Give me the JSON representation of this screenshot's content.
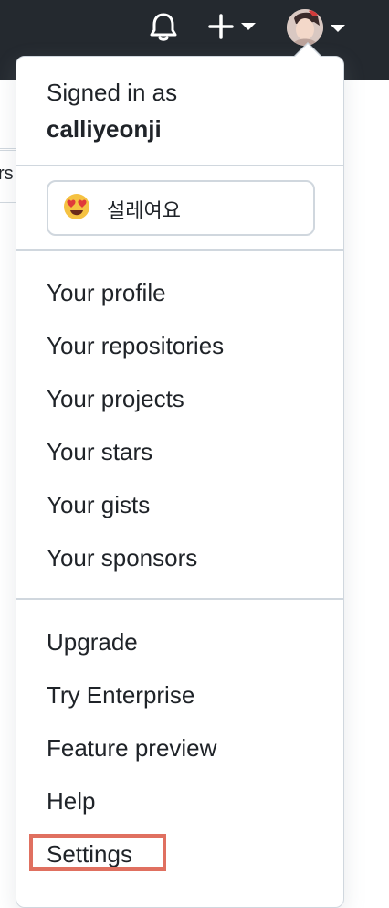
{
  "header": {
    "notifications_icon": "bell-icon",
    "create_icon": "plus-icon",
    "avatar_icon": "avatar"
  },
  "background": {
    "cut_text": "rs"
  },
  "menu": {
    "signed_in_label": "Signed in as",
    "username": "calliyeonji",
    "status": {
      "emoji": "heart-eyes-emoji",
      "text": "설레여요"
    },
    "group1": [
      "Your profile",
      "Your repositories",
      "Your projects",
      "Your stars",
      "Your gists",
      "Your sponsors"
    ],
    "group2": [
      "Upgrade",
      "Try Enterprise",
      "Feature preview",
      "Help",
      "Settings"
    ],
    "highlight_color": "#e07060"
  }
}
